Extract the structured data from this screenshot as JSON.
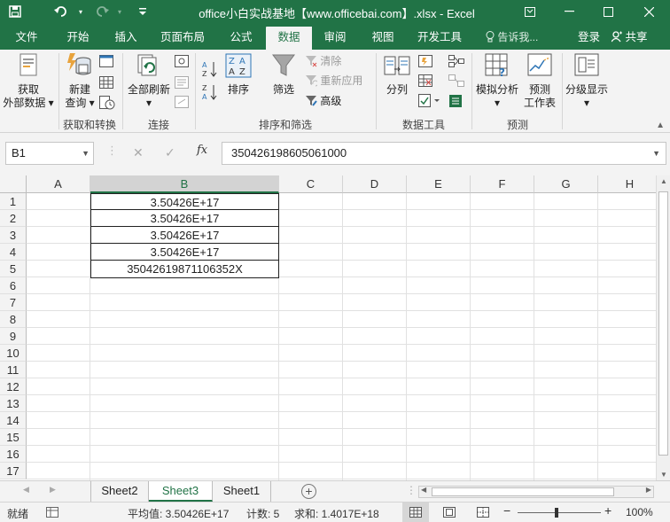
{
  "window": {
    "title": "office小白实战基地【www.officebai.com】.xlsx - Excel"
  },
  "tabs": [
    {
      "label": "文件",
      "active": false
    },
    {
      "label": "开始",
      "active": false
    },
    {
      "label": "插入",
      "active": false
    },
    {
      "label": "页面布局",
      "active": false
    },
    {
      "label": "公式",
      "active": false
    },
    {
      "label": "数据",
      "active": true
    },
    {
      "label": "审阅",
      "active": false
    },
    {
      "label": "视图",
      "active": false
    },
    {
      "label": "开发工具",
      "active": false
    }
  ],
  "tell_me": "告诉我...",
  "login": "登录",
  "share": "共享",
  "ribbon": {
    "get_external": "获取\n外部数据",
    "get_external_l1": "获取",
    "get_external_l2": "外部数据",
    "new_query_l1": "新建",
    "new_query_l2": "查询",
    "group_get_transform": "获取和转换",
    "refresh_all": "全部刷新",
    "group_connections": "连接",
    "sort": "排序",
    "filter": "筛选",
    "clear": "清除",
    "reapply": "重新应用",
    "advanced": "高级",
    "group_sort_filter": "排序和筛选",
    "text_to_columns": "分列",
    "group_data_tools": "数据工具",
    "what_if_l1": "模拟分析",
    "forecast_l1": "预测",
    "forecast_l2": "工作表",
    "group_forecast": "预测",
    "outline": "分级显示"
  },
  "formula_bar": {
    "name_box": "B1",
    "fx": "fx",
    "content": "350426198605061000"
  },
  "columns": [
    "A",
    "B",
    "C",
    "D",
    "E",
    "F",
    "G",
    "H"
  ],
  "rows": [
    "1",
    "2",
    "3",
    "4",
    "5",
    "6",
    "7",
    "8",
    "9",
    "10",
    "11",
    "12",
    "13",
    "14",
    "15",
    "16",
    "17"
  ],
  "cells": {
    "B1": "3.50426E+17",
    "B2": "3.50426E+17",
    "B3": "3.50426E+17",
    "B4": "3.50426E+17",
    "B5": "35042619871106352X"
  },
  "sheets": [
    {
      "name": "Sheet2",
      "active": false
    },
    {
      "name": "Sheet3",
      "active": true
    },
    {
      "name": "Sheet1",
      "active": false
    }
  ],
  "status": {
    "mode": "就绪",
    "average": "平均值: 3.50426E+17",
    "count": "计数: 5",
    "sum": "求和: 1.4017E+18",
    "zoom": "100%"
  },
  "colors": {
    "accent": "#217346",
    "ribbon_bg": "#f3f3f3"
  }
}
